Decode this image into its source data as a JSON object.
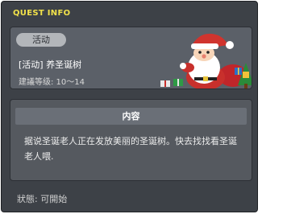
{
  "window": {
    "code": "9875-0",
    "title": "QUEST INFO"
  },
  "quest": {
    "tag": "活动",
    "name": "[活动] 养圣诞树",
    "level": "建議等级: 10～14"
  },
  "content": {
    "header": "内容",
    "description": "据说圣诞老人正在发放美丽的圣诞树。快去找找看圣诞老人喂."
  },
  "status": {
    "text": "狀態: 可開始"
  },
  "colors": {
    "window_bg": "#3d4147",
    "title": "#f2e24a",
    "panel_bg": "#5b6068",
    "tag_bg": "#b3b6ba"
  },
  "icons": [
    "santa-illustration",
    "gift-icon",
    "christmas-tree-icon"
  ]
}
